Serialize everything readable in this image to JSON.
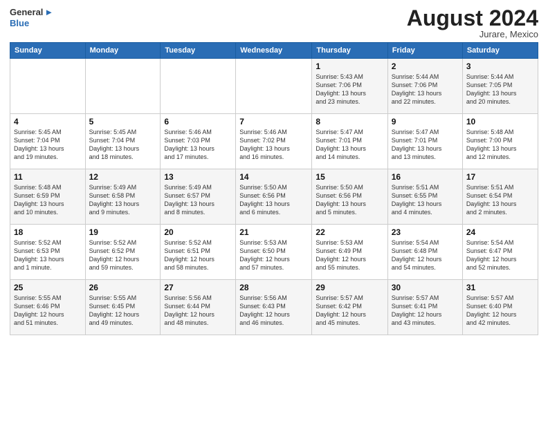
{
  "header": {
    "logo_general": "General",
    "logo_blue": "Blue",
    "month_year": "August 2024",
    "location": "Jurare, Mexico"
  },
  "days_of_week": [
    "Sunday",
    "Monday",
    "Tuesday",
    "Wednesday",
    "Thursday",
    "Friday",
    "Saturday"
  ],
  "weeks": [
    [
      {
        "day": "",
        "info": ""
      },
      {
        "day": "",
        "info": ""
      },
      {
        "day": "",
        "info": ""
      },
      {
        "day": "",
        "info": ""
      },
      {
        "day": "1",
        "info": "Sunrise: 5:43 AM\nSunset: 7:06 PM\nDaylight: 13 hours\nand 23 minutes."
      },
      {
        "day": "2",
        "info": "Sunrise: 5:44 AM\nSunset: 7:06 PM\nDaylight: 13 hours\nand 22 minutes."
      },
      {
        "day": "3",
        "info": "Sunrise: 5:44 AM\nSunset: 7:05 PM\nDaylight: 13 hours\nand 20 minutes."
      }
    ],
    [
      {
        "day": "4",
        "info": "Sunrise: 5:45 AM\nSunset: 7:04 PM\nDaylight: 13 hours\nand 19 minutes."
      },
      {
        "day": "5",
        "info": "Sunrise: 5:45 AM\nSunset: 7:04 PM\nDaylight: 13 hours\nand 18 minutes."
      },
      {
        "day": "6",
        "info": "Sunrise: 5:46 AM\nSunset: 7:03 PM\nDaylight: 13 hours\nand 17 minutes."
      },
      {
        "day": "7",
        "info": "Sunrise: 5:46 AM\nSunset: 7:02 PM\nDaylight: 13 hours\nand 16 minutes."
      },
      {
        "day": "8",
        "info": "Sunrise: 5:47 AM\nSunset: 7:01 PM\nDaylight: 13 hours\nand 14 minutes."
      },
      {
        "day": "9",
        "info": "Sunrise: 5:47 AM\nSunset: 7:01 PM\nDaylight: 13 hours\nand 13 minutes."
      },
      {
        "day": "10",
        "info": "Sunrise: 5:48 AM\nSunset: 7:00 PM\nDaylight: 13 hours\nand 12 minutes."
      }
    ],
    [
      {
        "day": "11",
        "info": "Sunrise: 5:48 AM\nSunset: 6:59 PM\nDaylight: 13 hours\nand 10 minutes."
      },
      {
        "day": "12",
        "info": "Sunrise: 5:49 AM\nSunset: 6:58 PM\nDaylight: 13 hours\nand 9 minutes."
      },
      {
        "day": "13",
        "info": "Sunrise: 5:49 AM\nSunset: 6:57 PM\nDaylight: 13 hours\nand 8 minutes."
      },
      {
        "day": "14",
        "info": "Sunrise: 5:50 AM\nSunset: 6:56 PM\nDaylight: 13 hours\nand 6 minutes."
      },
      {
        "day": "15",
        "info": "Sunrise: 5:50 AM\nSunset: 6:56 PM\nDaylight: 13 hours\nand 5 minutes."
      },
      {
        "day": "16",
        "info": "Sunrise: 5:51 AM\nSunset: 6:55 PM\nDaylight: 13 hours\nand 4 minutes."
      },
      {
        "day": "17",
        "info": "Sunrise: 5:51 AM\nSunset: 6:54 PM\nDaylight: 13 hours\nand 2 minutes."
      }
    ],
    [
      {
        "day": "18",
        "info": "Sunrise: 5:52 AM\nSunset: 6:53 PM\nDaylight: 13 hours\nand 1 minute."
      },
      {
        "day": "19",
        "info": "Sunrise: 5:52 AM\nSunset: 6:52 PM\nDaylight: 12 hours\nand 59 minutes."
      },
      {
        "day": "20",
        "info": "Sunrise: 5:52 AM\nSunset: 6:51 PM\nDaylight: 12 hours\nand 58 minutes."
      },
      {
        "day": "21",
        "info": "Sunrise: 5:53 AM\nSunset: 6:50 PM\nDaylight: 12 hours\nand 57 minutes."
      },
      {
        "day": "22",
        "info": "Sunrise: 5:53 AM\nSunset: 6:49 PM\nDaylight: 12 hours\nand 55 minutes."
      },
      {
        "day": "23",
        "info": "Sunrise: 5:54 AM\nSunset: 6:48 PM\nDaylight: 12 hours\nand 54 minutes."
      },
      {
        "day": "24",
        "info": "Sunrise: 5:54 AM\nSunset: 6:47 PM\nDaylight: 12 hours\nand 52 minutes."
      }
    ],
    [
      {
        "day": "25",
        "info": "Sunrise: 5:55 AM\nSunset: 6:46 PM\nDaylight: 12 hours\nand 51 minutes."
      },
      {
        "day": "26",
        "info": "Sunrise: 5:55 AM\nSunset: 6:45 PM\nDaylight: 12 hours\nand 49 minutes."
      },
      {
        "day": "27",
        "info": "Sunrise: 5:56 AM\nSunset: 6:44 PM\nDaylight: 12 hours\nand 48 minutes."
      },
      {
        "day": "28",
        "info": "Sunrise: 5:56 AM\nSunset: 6:43 PM\nDaylight: 12 hours\nand 46 minutes."
      },
      {
        "day": "29",
        "info": "Sunrise: 5:57 AM\nSunset: 6:42 PM\nDaylight: 12 hours\nand 45 minutes."
      },
      {
        "day": "30",
        "info": "Sunrise: 5:57 AM\nSunset: 6:41 PM\nDaylight: 12 hours\nand 43 minutes."
      },
      {
        "day": "31",
        "info": "Sunrise: 5:57 AM\nSunset: 6:40 PM\nDaylight: 12 hours\nand 42 minutes."
      }
    ]
  ]
}
